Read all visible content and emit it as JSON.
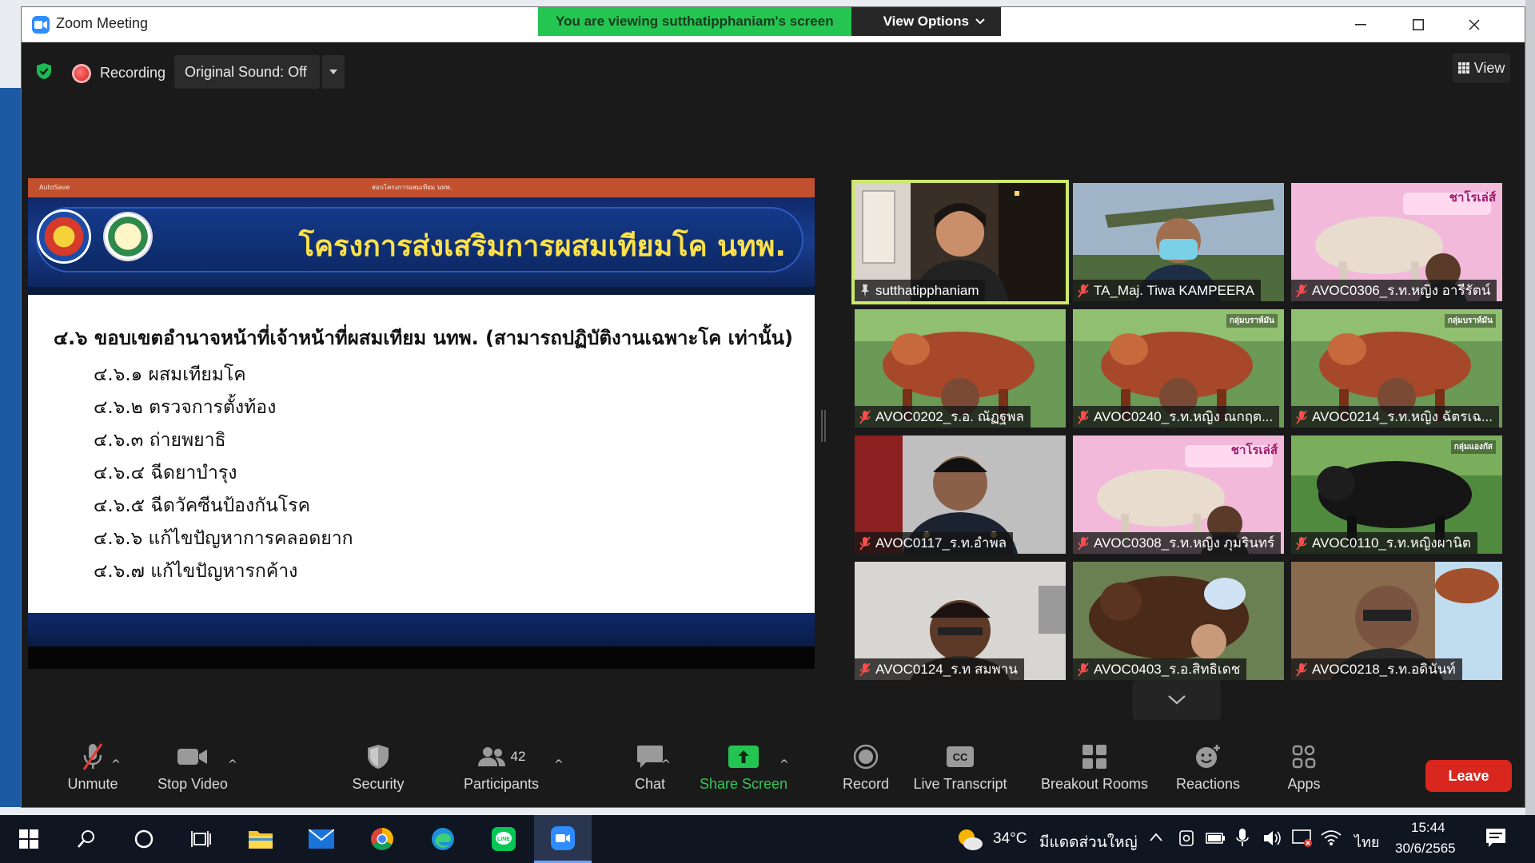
{
  "window": {
    "title": "Zoom Meeting",
    "share_banner": "You are viewing sutthatipphaniam's screen",
    "view_options": "View Options"
  },
  "topbar": {
    "recording_label": "Recording",
    "original_sound": "Original Sound: Off",
    "view_label": "View"
  },
  "slide": {
    "app_title": "AutoSave",
    "doc_title": "สอบโครงการผสมเทียม นทพ.",
    "banner_title": "โครงการส่งเสริมการผสมเทียมโค นทพ.",
    "heading": "๔.๖ ขอบเขตอำนาจหน้าที่เจ้าหน้าที่ผสมเทียม นทพ. (สามารถปฏิบัติงานเฉพาะโค เท่านั้น)",
    "items": [
      "๔.๖.๑ ผสมเทียมโค",
      "๔.๖.๒ ตรวจการตั้งท้อง",
      "๔.๖.๓ ถ่ายพยาธิ",
      "๔.๖.๔ ฉีดยาบำรุง",
      "๔.๖.๕ ฉีดวัคซีนป้องกันโรค",
      "๔.๖.๖ แก้ไขปัญหาการคลอดยาก",
      "๔.๖.๗ แก้ไขปัญหารกค้าง"
    ]
  },
  "participants": [
    {
      "name": "sutthatipphaniam",
      "muted": false,
      "active": true,
      "scene": "person-indoor"
    },
    {
      "name": "TA_Maj. Tiwa KAMPEERA",
      "muted": true,
      "active": false,
      "scene": "person-missile"
    },
    {
      "name": "AVOC0306_ร.ท.หญิง อารีรัตน์",
      "muted": true,
      "active": false,
      "scene": "pink-cow",
      "overlay_text": "ชาโรเล่ส์"
    },
    {
      "name": "AVOC0202_ร.อ. ณัฏฐพล",
      "muted": true,
      "active": false,
      "scene": "red-cow"
    },
    {
      "name": "AVOC0240_ร.ท.หญิง ณกฤต...",
      "muted": true,
      "active": false,
      "scene": "red-cow",
      "overlay_text": "กลุ่มบราห์มัน"
    },
    {
      "name": "AVOC0214_ร.ท.หญิง ฉัตรเฉ...",
      "muted": true,
      "active": false,
      "scene": "red-cow",
      "overlay_text": "กลุ่มบราห์มัน"
    },
    {
      "name": "AVOC0117_ร.ท.อำพล",
      "muted": true,
      "active": false,
      "scene": "person-uniform"
    },
    {
      "name": "AVOC0308_ร.ท.หญิง ภุมรินทร์",
      "muted": true,
      "active": false,
      "scene": "pink-cow",
      "overlay_text": "ชาโรเล่ส์"
    },
    {
      "name": "AVOC0110_ร.ท.หญิงผานิต",
      "muted": true,
      "active": false,
      "scene": "black-cow",
      "overlay_text": "กลุ่มแองกัส"
    },
    {
      "name": "AVOC0124_ร.ท สมพาน",
      "muted": true,
      "active": false,
      "scene": "person-wall"
    },
    {
      "name": "AVOC0403_ร.อ.สิทธิเดช",
      "muted": true,
      "active": false,
      "scene": "brown-cow"
    },
    {
      "name": "AVOC0218_ร.ท.อดินันท์",
      "muted": true,
      "active": false,
      "scene": "person-cow"
    }
  ],
  "toolbar": {
    "unmute": "Unmute",
    "stop_video": "Stop Video",
    "security": "Security",
    "participants": "Participants",
    "participant_count": "42",
    "chat": "Chat",
    "share_screen": "Share Screen",
    "record": "Record",
    "live_transcript": "Live Transcript",
    "breakout_rooms": "Breakout Rooms",
    "reactions": "Reactions",
    "apps": "Apps",
    "leave": "Leave"
  },
  "taskbar": {
    "weather_temp": "34°C",
    "weather_desc": "มีแดดส่วนใหญ่",
    "language": "ไทย",
    "time": "15:44",
    "date": "30/6/2565"
  },
  "colors": {
    "accent_green": "#25c552",
    "active_speaker": "#cde86b",
    "leave_red": "#d9271f",
    "slide_title_yellow": "#ffe14a",
    "zoom_blue": "#2d8cff"
  }
}
